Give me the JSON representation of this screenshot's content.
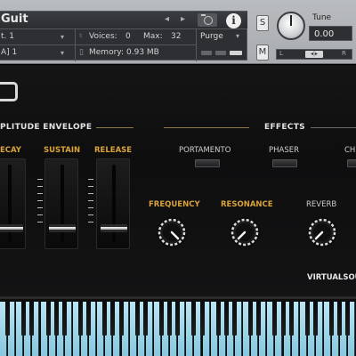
{
  "header": {
    "instrument_title": "Guit",
    "prev_arrow": "◂",
    "next_arrow": "▸",
    "output_value": "t. 1",
    "midi_value": "A] 1",
    "voices_label": "Voices:",
    "voices_value": "0",
    "max_label": "Max:",
    "max_value": "32",
    "memory_label": "Memory:",
    "memory_value": "0.93 MB",
    "purge_label": "Purge",
    "solo_label": "S",
    "mute_label": "M",
    "tune_label": "Tune",
    "tune_value": "0.00",
    "pan_left": "L",
    "pan_right": "R",
    "pan_center": "◂|▸",
    "icons": [
      "camera-icon",
      "info-icon",
      "voices-icon",
      "memory-icon"
    ]
  },
  "amp_envelope": {
    "title": "PLITUDE ENVELOPE",
    "labels": [
      "ECAY",
      "SUSTAIN",
      "RELEASE"
    ],
    "levels": [
      0.2,
      0.2,
      0.2
    ]
  },
  "effects": {
    "title": "EFFECTS",
    "switches": [
      "PORTAMENTO",
      "PHASER",
      "CH"
    ],
    "knobs": [
      {
        "label": "FREQUENCY",
        "color": "#d9a33a"
      },
      {
        "label": "RESONANCE",
        "color": "#d9a33a"
      },
      {
        "label": "REVERB",
        "color": "#cfcfcf"
      }
    ]
  },
  "brand": "VIRTUALSOU",
  "keyboard": {
    "key_color": "#a9dcee"
  }
}
